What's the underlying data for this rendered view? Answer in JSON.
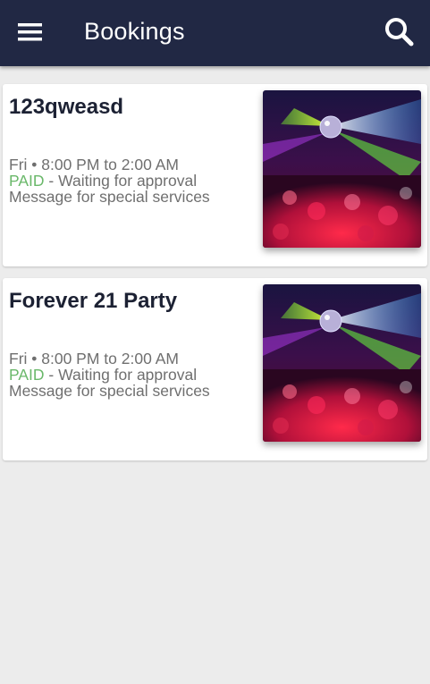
{
  "appbar": {
    "title": "Bookings",
    "menu_icon": "menu-icon",
    "search_icon": "search-icon",
    "background": "#212844"
  },
  "bookings": [
    {
      "name": "123qweasd",
      "schedule": "Fri • 8:00 PM to 2:00 AM",
      "payment_status": "PAID",
      "approval_status": " - Waiting for approval",
      "message": "Message for special services",
      "image": "nightclub-party-image"
    },
    {
      "name": "Forever 21 Party",
      "schedule": "Fri • 8:00 PM to 2:00 AM",
      "payment_status": "PAID",
      "approval_status": " - Waiting for approval",
      "message": "Message for special services",
      "image": "nightclub-party-image"
    }
  ],
  "colors": {
    "paid": "#6ab86a",
    "page_background": "#ececec"
  }
}
